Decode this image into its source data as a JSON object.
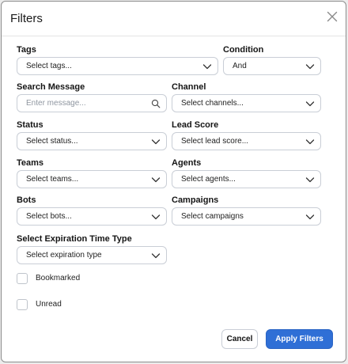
{
  "header": {
    "title": "Filters"
  },
  "fields": {
    "tags": {
      "label": "Tags",
      "value": "Select tags..."
    },
    "condition": {
      "label": "Condition",
      "value": "And"
    },
    "search_message": {
      "label": "Search Message",
      "placeholder": "Enter message..."
    },
    "channel": {
      "label": "Channel",
      "value": "Select channels..."
    },
    "status": {
      "label": "Status",
      "value": "Select status..."
    },
    "lead_score": {
      "label": "Lead Score",
      "value": "Select lead score..."
    },
    "teams": {
      "label": "Teams",
      "value": "Select teams..."
    },
    "agents": {
      "label": "Agents",
      "value": "Select agents..."
    },
    "bots": {
      "label": "Bots",
      "value": "Select bots..."
    },
    "campaigns": {
      "label": "Campaigns",
      "value": "Select campaigns"
    },
    "expiration": {
      "label": "Select Expiration Time Type",
      "value": "Select expiration type"
    }
  },
  "checkboxes": {
    "bookmarked": {
      "label": "Bookmarked",
      "checked": false
    },
    "unread": {
      "label": "Unread",
      "checked": false
    }
  },
  "footer": {
    "cancel_label": "Cancel",
    "apply_label": "Apply Filters"
  },
  "colors": {
    "primary": "#2f6fd6",
    "border": "#c9ced6",
    "placeholder": "#8f96a0"
  },
  "icons": [
    "close-icon",
    "chevron-down-icon",
    "search-icon"
  ]
}
